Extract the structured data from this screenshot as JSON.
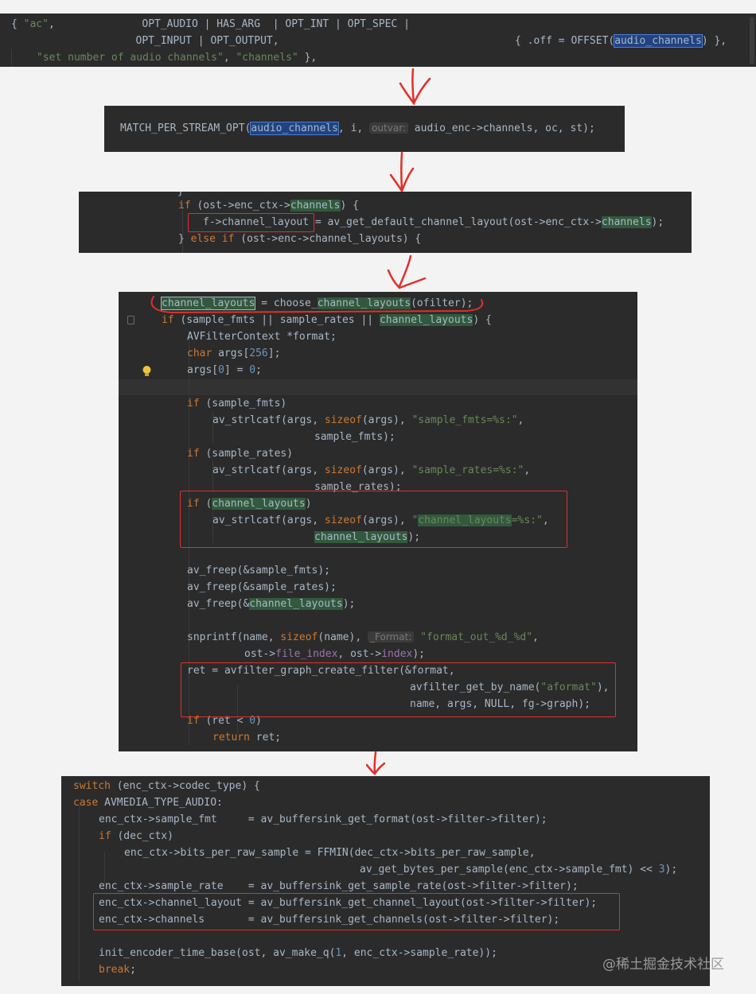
{
  "panel1": {
    "l1_a": "{ ",
    "l1_str": "\"ac\"",
    "l1_b": ",              OPT_AUDIO | HAS_ARG  | OPT_INT | OPT_SPEC |",
    "l2_a": "                    OPT_INPUT | OPT_OUTPUT,",
    "l2_b": "{ .off = OFFSET(",
    "l2_hl": "audio_channels",
    "l2_c": ") },",
    "l3_str1": "\"set number of audio channels\"",
    "l3_mid": ", ",
    "l3_str2": "\"channels\"",
    "l3_end": " },"
  },
  "panel2": {
    "a": "MATCH_PER_STREAM_OPT(",
    "hl": "audio_channels",
    "b": ", i, ",
    "hint": "outvar:",
    "c": " audio_enc->channels, oc, st);"
  },
  "panel3": {
    "l0": "}",
    "l1_kw": "if",
    "l1_a": " (ost->enc_ctx->",
    "l1_hl": "channels",
    "l1_b": ") {",
    "l2_box": "f->channel_layout",
    "l2_a": " = av_get_default_channel_layout(ost->enc_ctx->",
    "l2_hl": "channels",
    "l2_b": ");",
    "l3_a": "} ",
    "l3_kw": "else if",
    "l3_b": " (ost->enc->channel_layouts) {"
  },
  "panel4": {
    "l1_hl": "channel_layouts",
    "l1_a": " = choose_",
    "l1_hl2": "channel_layouts",
    "l1_b": "(ofilter);",
    "l2_kw": "if",
    "l2_a": " (sample_fmts || sample_rates || ",
    "l2_hl": "channel_layouts",
    "l2_b": ") {",
    "l3": "AVFilterContext *format;",
    "l4_kw": "char",
    "l4_a": " args[",
    "l4_num": "256",
    "l4_b": "];",
    "l5_a": "args[",
    "l5_n1": "0",
    "l5_b": "] = ",
    "l5_n2": "0",
    "l5_c": ";",
    "l7_kw": "if",
    "l7_a": " (sample_fmts)",
    "l8_a": "av_strlcatf(args, ",
    "l8_kw": "sizeof",
    "l8_b": "(args), ",
    "l8_str": "\"sample_fmts=%s:\"",
    "l8_c": ",",
    "l9": "sample_fmts);",
    "l10_kw": "if",
    "l10_a": " (sample_rates)",
    "l11_a": "av_strlcatf(args, ",
    "l11_kw": "sizeof",
    "l11_b": "(args), ",
    "l11_str": "\"sample_rates=%s:\"",
    "l11_c": ",",
    "l12": "sample_rates);",
    "l13_kw": "if",
    "l13_a": " (",
    "l13_hl": "channel_layouts",
    "l13_b": ")",
    "l14_a": "av_strlcatf(args, ",
    "l14_kw": "sizeof",
    "l14_b": "(args), ",
    "l14_q": "\"",
    "l14_hl": "channel_layouts",
    "l14_str": "=%s:\"",
    "l14_c": ",",
    "l15_hl": "channel_layouts",
    "l15_b": ");",
    "l17": "av_freep(&sample_fmts);",
    "l18": "av_freep(&sample_rates);",
    "l19_a": "av_freep(&",
    "l19_hl": "channel_layouts",
    "l19_b": ");",
    "l21_a": "snprintf(name, ",
    "l21_kw": "sizeof",
    "l21_b": "(name), ",
    "l21_hint": "_Format:",
    "l21_str": "\"format_out_%d_%d\"",
    "l21_c": ",",
    "l22_a": "ost->",
    "l22_f1": "file_index",
    "l22_b": ", ost->",
    "l22_f2": "index",
    "l22_c": ");",
    "l23": "ret = avfilter_graph_create_filter(&format,",
    "l24_a": "avfilter_get_by_name(",
    "l24_str": "\"aformat\"",
    "l24_b": "),",
    "l25": "name, args, NULL, fg->graph);",
    "l26_kw": "if",
    "l26_a": " (ret < ",
    "l26_num": "0",
    "l26_b": ")",
    "l27_kw": "return",
    "l27_a": " ret;"
  },
  "panel5": {
    "l1_kw": "switch",
    "l1_a": " (enc_ctx->codec_type) {",
    "l2_kw": "case",
    "l2_a": " AVMEDIA_TYPE_AUDIO:",
    "l3": "enc_ctx->sample_fmt     = av_buffersink_get_format(ost->filter->filter);",
    "l4_kw": "if",
    "l4_a": " (dec_ctx)",
    "l5": "enc_ctx->bits_per_raw_sample = FFMIN(dec_ctx->bits_per_raw_sample,",
    "l6_a": "av_get_bytes_per_sample(enc_ctx->sample_fmt) << ",
    "l6_num": "3",
    "l6_b": ");",
    "l7": "enc_ctx->sample_rate    = av_buffersink_get_sample_rate(ost->filter->filter);",
    "l8": "enc_ctx->channel_layout = av_buffersink_get_channel_layout(ost->filter->filter);",
    "l9": "enc_ctx->channels       = av_buffersink_get_channels(ost->filter->filter);",
    "l11_a": "init_encoder_time_base(ost, av_make_q(",
    "l11_num": "1",
    "l11_b": ", enc_ctx->sample_rate));",
    "l12_kw": "break",
    "l12_a": ";"
  },
  "watermark": "@稀土掘金技术社区",
  "colors": {
    "annotation_red": "#e0302a",
    "editor_bg": "#2b2b2b",
    "keyword": "#cc7832",
    "string": "#6a8759",
    "number": "#6897bb",
    "field": "#9876aa"
  },
  "icons": [
    "lightbulb-icon",
    "fold-marker-icon",
    "hand-drawn-arrow-icon"
  ]
}
